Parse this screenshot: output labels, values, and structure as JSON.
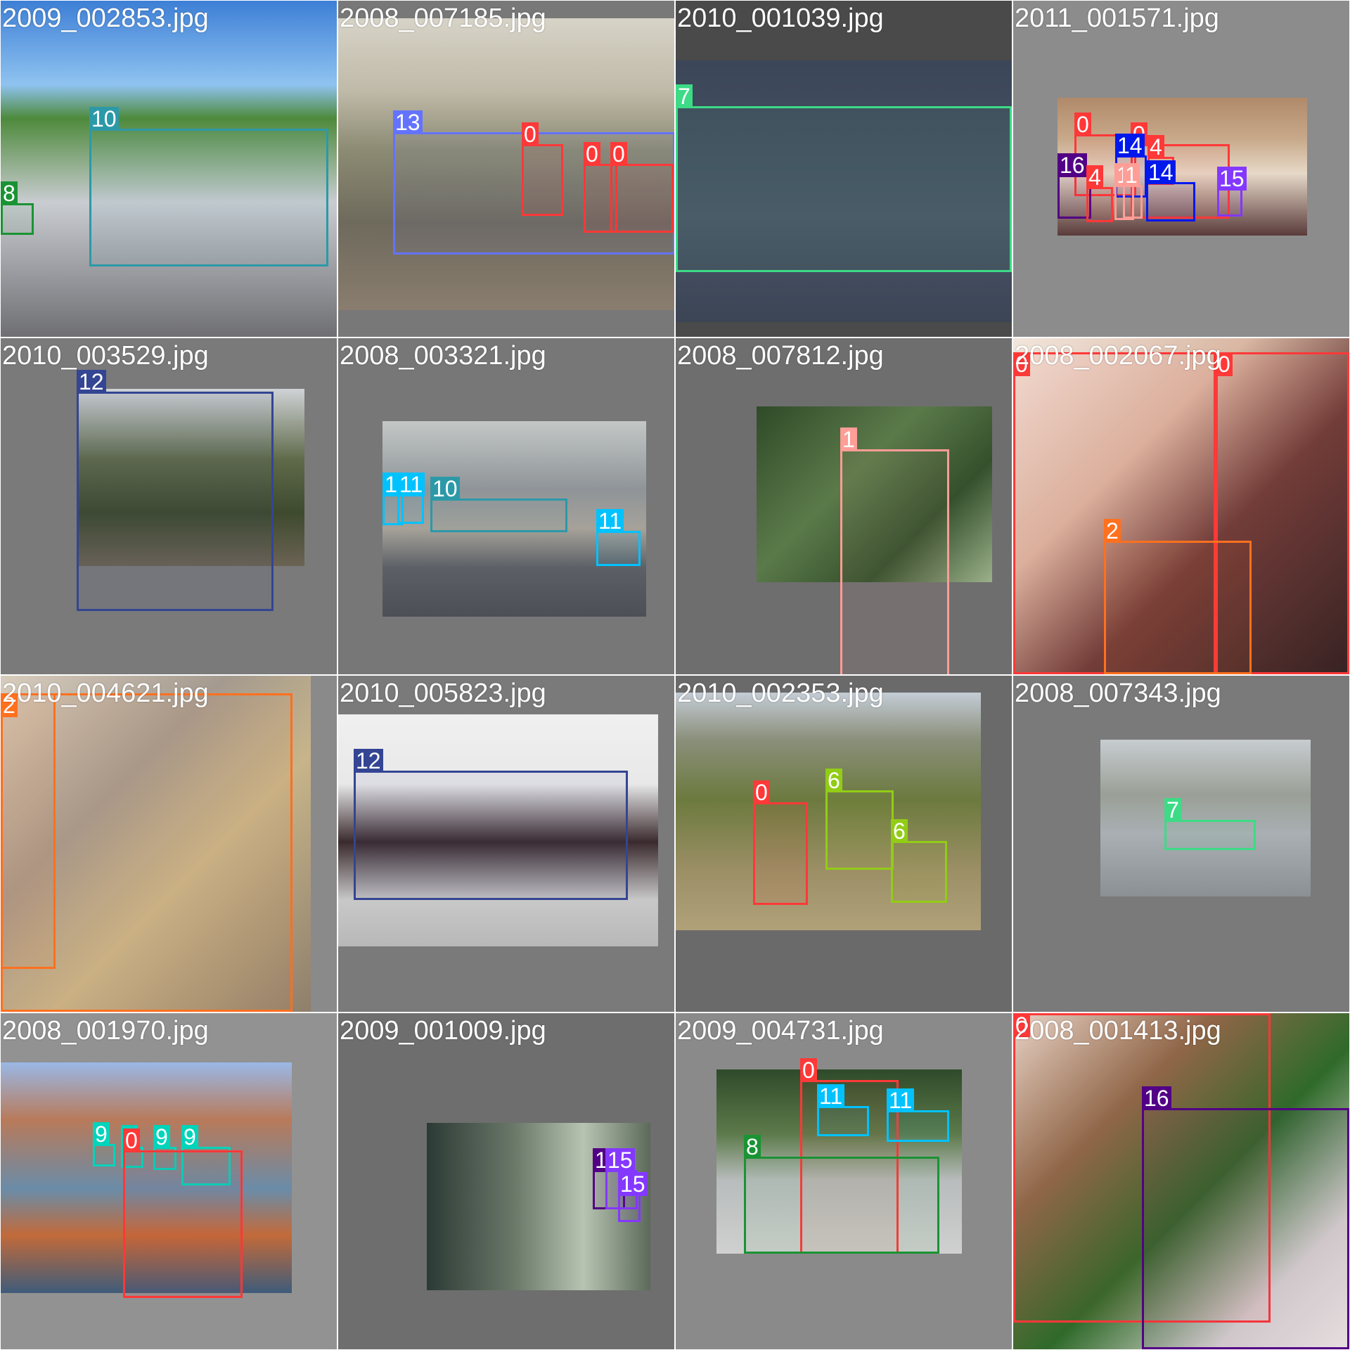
{
  "class_colors": {
    "0": "#ff3838",
    "1": "#ff9d97",
    "2": "#ff701f",
    "6": "#92cc17",
    "7": "#3ddb86",
    "8": "#1a9334",
    "9": "#00d4bb",
    "10": "#2c99a8",
    "11": "#00c2ff",
    "12": "#344593",
    "13": "#6473ff",
    "14": "#0018ec",
    "15": "#8438ff",
    "16": "#520085"
  },
  "tiles": [
    {
      "filename": "2009_002853.jpg",
      "bg": "#787878",
      "photo_bg": "linear-gradient(180deg,#3d7fd6 0%,#8fc3f0 25%,#4e8a3c 35%,#c9ccd1 60%,#6f6f73 100%)",
      "boxes": [
        {
          "label": "10"
        },
        {
          "label": "8"
        }
      ]
    },
    {
      "filename": "2008_007185.jpg",
      "bg": "#787878",
      "photo_bg": "linear-gradient(180deg,#d7d3c7 0%,#bfbaa8 25%,#8c8b73 45%,#6e6a5c 70%,#8a7d6f 100%)",
      "boxes": [
        {
          "label": "13"
        },
        {
          "label": "0"
        },
        {
          "label": "0"
        },
        {
          "label": "0"
        }
      ]
    },
    {
      "filename": "2010_001039.jpg",
      "bg": "#4a4a4a",
      "photo_bg": "linear-gradient(180deg,#3b4658 0%,#4a5466 60%,#3c4556 100%)",
      "boxes": [
        {
          "label": "7"
        }
      ]
    },
    {
      "filename": "2011_001571.jpg",
      "bg": "#8c8c8c",
      "photo_bg": "linear-gradient(180deg,#b08a6a 0%,#c8a98a 30%,#e6d9c8 55%,#5a3b3b 100%)",
      "boxes": [
        {
          "label": "0"
        },
        {
          "label": "0"
        },
        {
          "label": "14"
        },
        {
          "label": "4"
        },
        {
          "label": "16"
        },
        {
          "label": "4"
        },
        {
          "label": "1"
        },
        {
          "label": "1"
        },
        {
          "label": "14"
        },
        {
          "label": "15"
        }
      ]
    },
    {
      "filename": "2010_003529.jpg",
      "bg": "#7a7a7a",
      "photo_bg": "linear-gradient(180deg,#cfd3d6 0%,#5f6a4a 40%,#3e4a2e 70%,#6b6354 100%)",
      "boxes": [
        {
          "label": "12"
        }
      ]
    },
    {
      "filename": "2008_003321.jpg",
      "bg": "#777777",
      "photo_bg": "linear-gradient(180deg,#c3c8c6 0%,#8f9498 35%,#a6a29a 55%,#5c6066 75%,#4c5056 100%)",
      "boxes": [
        {
          "label": "10"
        },
        {
          "label": "11"
        },
        {
          "label": "11"
        },
        {
          "label": "11"
        }
      ]
    },
    {
      "filename": "2008_007812.jpg",
      "bg": "#6e6e6e",
      "photo_bg": "linear-gradient(135deg,#2f4a28 0%,#5b7a4a 40%,#34502c 70%,#9bb08a 100%)",
      "boxes": [
        {
          "label": "1"
        }
      ]
    },
    {
      "filename": "2008_002067.jpg",
      "bg": "#6e6e6e",
      "photo_bg": "linear-gradient(135deg,#f2e6dc 0%,#d9b7a3 35%,#6b3e3a 60%,#2b2222 100%)",
      "boxes": [
        {
          "label": "0"
        },
        {
          "label": "0"
        },
        {
          "label": "2"
        }
      ]
    },
    {
      "filename": "2010_004621.jpg",
      "bg": "#8a8a8a",
      "photo_bg": "linear-gradient(135deg,#d8cdbd 0%,#a49a8f 35%,#c7b48a 60%,#8e7f6c 100%)",
      "boxes": [
        {
          "label": "2"
        },
        {
          "label": "2"
        }
      ]
    },
    {
      "filename": "2010_005823.jpg",
      "bg": "#7a7a7a",
      "photo_bg": "linear-gradient(180deg,#f0f0f0 0%,#e8e8e8 30%,#3a2a2e 55%,#c8c8c8 80%,#b8b8b8 100%)",
      "boxes": [
        {
          "label": "12"
        }
      ]
    },
    {
      "filename": "2010_002353.jpg",
      "bg": "#6a6a6a",
      "photo_bg": "linear-gradient(180deg,#c4ccd6 0%,#8a8f7a 20%,#6c7a3e 45%,#9c8f66 75%,#b0a179 100%)",
      "boxes": [
        {
          "label": "0"
        },
        {
          "label": "6"
        },
        {
          "label": "6"
        }
      ]
    },
    {
      "filename": "2008_007343.jpg",
      "bg": "#7a7a7a",
      "photo_bg": "linear-gradient(180deg,#c7ccd0 0%,#9aa096 35%,#a9afb3 60%,#8a9093 100%)",
      "boxes": [
        {
          "label": "7"
        }
      ]
    },
    {
      "filename": "2008_001970.jpg",
      "bg": "#929292",
      "photo_bg": "linear-gradient(180deg,#9ab8e6 0%,#b87a5a 25%,#6a8ca8 55%,#c26a3a 75%,#3e5c7a 100%)",
      "boxes": [
        {
          "label": "9"
        },
        {
          "label": "9"
        },
        {
          "label": "9"
        },
        {
          "label": "9"
        },
        {
          "label": "0"
        }
      ]
    },
    {
      "filename": "2009_001009.jpg",
      "bg": "#6e6e6e",
      "photo_bg": "linear-gradient(90deg,#2c3a36 0%,#6b7a6a 40%,#b8c4b2 70%,#5c6a5a 100%)",
      "boxes": [
        {
          "label": "16"
        },
        {
          "label": "15"
        },
        {
          "label": "15"
        }
      ]
    },
    {
      "filename": "2009_004731.jpg",
      "bg": "#8a8a8a",
      "photo_bg": "linear-gradient(180deg,#2f4a2a 0%,#5c7a4a 35%,#b8bcbc 60%,#d0d0d0 100%)",
      "boxes": [
        {
          "label": "0"
        },
        {
          "label": "11"
        },
        {
          "label": "11"
        },
        {
          "label": "8"
        }
      ]
    },
    {
      "filename": "2008_001413.jpg",
      "bg": "#6e6e6e",
      "photo_bg": "linear-gradient(135deg,#e8ddd0 0%,#8a6a4a 30%,#2f6a2a 55%,#d8d4cf 80%,#f0ece6 100%)",
      "boxes": [
        {
          "label": "0"
        },
        {
          "label": "16"
        }
      ]
    }
  ]
}
